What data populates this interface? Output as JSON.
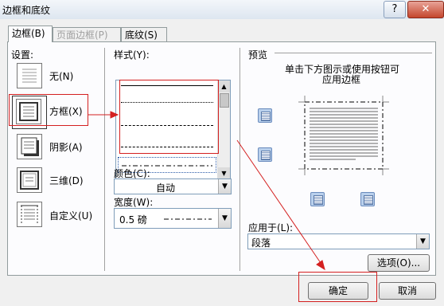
{
  "window": {
    "title": "边框和底纹",
    "help_glyph": "?",
    "close_glyph": "✕"
  },
  "tabs": [
    {
      "label": "边框(B)",
      "active": true
    },
    {
      "label": "页面边框(P)",
      "disabled": true
    },
    {
      "label": "底纹(S)"
    }
  ],
  "settings": {
    "header": "设置:",
    "items": [
      "无(N)",
      "方框(X)",
      "阴影(A)",
      "三维(D)",
      "自定义(U)"
    ],
    "selected": "方框(X)"
  },
  "style": {
    "header": "样式(Y):"
  },
  "color": {
    "label": "颜色(C):",
    "value": "自动"
  },
  "width": {
    "label": "宽度(W):",
    "value": "0.5 磅"
  },
  "preview": {
    "header": "预览",
    "instruction_line1": "单击下方图示或使用按钮可",
    "instruction_line2": "应用边框"
  },
  "apply_to": {
    "label": "应用于(L):",
    "value": "段落"
  },
  "buttons": {
    "options": "选项(O)...",
    "ok": "确定",
    "cancel": "取消"
  },
  "colors": {
    "annotation": "#d42020",
    "title_bar": "#dde6f0"
  }
}
